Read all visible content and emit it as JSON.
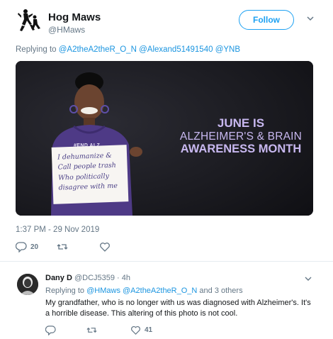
{
  "tweet": {
    "author_name": "Hog Maws",
    "author_handle": "@HMaws",
    "follow_label": "Follow",
    "replying_prefix": "Replying to",
    "replying_mentions": [
      "@A2theA2theR_O_N",
      "@Alexand51491540",
      "@YNB"
    ],
    "media": {
      "headline_line1": "JUNE IS",
      "headline_line2": "ALZHEIMER'S & BRAIN",
      "headline_line3": "AWARENESS MONTH",
      "hoodie_text": "#END ALZ",
      "sign_lines": [
        "I dehumanize &",
        "Call people trash",
        "Who politically",
        "disagree with me"
      ]
    },
    "timestamp": "1:37 PM - 29 Nov 2019",
    "reply_count": "20",
    "icons": {
      "reply": "reply-icon",
      "retweet": "retweet-icon",
      "like": "heart-icon",
      "caret": "chevron-down-icon"
    }
  },
  "reply": {
    "author_name": "Dany D",
    "author_handle": "@DCJ5359 · 4h",
    "replying_prefix": "Replying to",
    "replying_mentions": [
      "@HMaws",
      "@A2theA2theR_O_N"
    ],
    "replying_suffix": "and 3 others",
    "text": "My grandfather, who is no longer with us was diagnosed with Alzheimer's. It's a horrible disease. This altering of this photo is not cool.",
    "like_count": "41"
  },
  "colors": {
    "accent": "#1da1f2",
    "mention": "#1b95e0",
    "muted": "#657786",
    "text": "#14171a",
    "divider": "#e6ecf0",
    "media_purple": "#c8b8f0"
  }
}
